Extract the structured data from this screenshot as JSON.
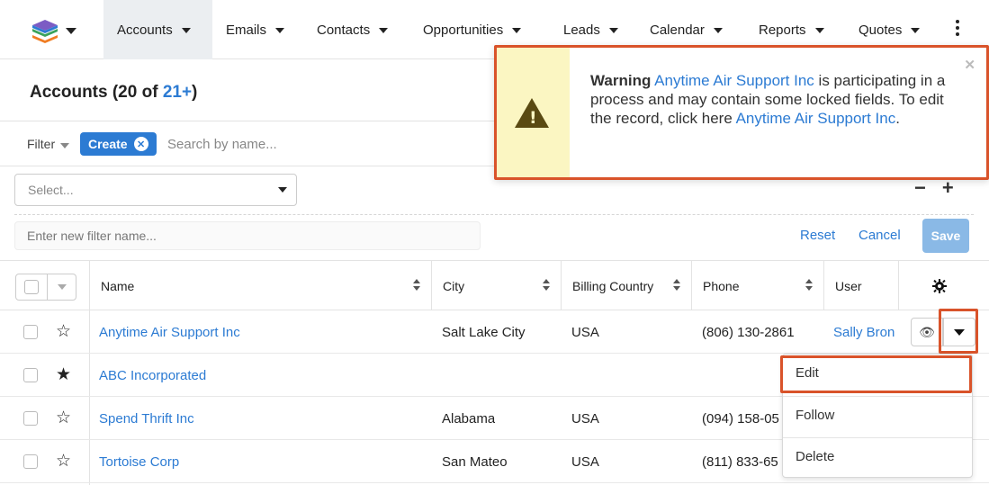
{
  "nav": {
    "items": [
      {
        "label": "Accounts"
      },
      {
        "label": "Emails"
      },
      {
        "label": "Contacts"
      },
      {
        "label": "Opportunities"
      },
      {
        "label": "Leads"
      },
      {
        "label": "Calendar"
      },
      {
        "label": "Reports"
      },
      {
        "label": "Quotes"
      }
    ]
  },
  "list": {
    "title_prefix": "Accounts (20 of ",
    "title_count": "21+",
    "title_suffix": ")"
  },
  "filter": {
    "label": "Filter",
    "create_pill": "Create",
    "search_placeholder": "Search by name...",
    "select_placeholder": "Select...",
    "filter_name_placeholder": "Enter new filter name...",
    "reset": "Reset",
    "cancel": "Cancel",
    "save": "Save"
  },
  "table": {
    "columns": [
      "Name",
      "City",
      "Billing Country",
      "Phone",
      "User"
    ],
    "rows": [
      {
        "name": "Anytime Air Support Inc",
        "city": "Salt Lake City",
        "country": "USA",
        "phone": "(806) 130-2861",
        "user": "Sally Bron",
        "favorite": false
      },
      {
        "name": "ABC Incorporated",
        "city": "",
        "country": "",
        "phone": "",
        "user": "",
        "favorite": true
      },
      {
        "name": "Spend Thrift Inc",
        "city": "Alabama",
        "country": "USA",
        "phone": "(094) 158-05",
        "user": "",
        "favorite": false
      },
      {
        "name": "Tortoise Corp",
        "city": "San Mateo",
        "country": "USA",
        "phone": "(811) 833-65",
        "user": "",
        "favorite": false
      }
    ]
  },
  "row_menu": {
    "items": [
      "Edit",
      "Follow",
      "Delete"
    ]
  },
  "warning": {
    "bold": "Warning",
    "record_link": "Anytime Air Support Inc",
    "message": " is participating in a process and may contain some locked fields. To edit the record, click here ",
    "edit_link": "Anytime Air Support Inc",
    "end": "."
  },
  "colors": {
    "accent": "#2c7bd3",
    "highlight": "#d9532a",
    "warning_bg": "#fbf6c2"
  },
  "icons": [
    "logo-icon",
    "caret-down-icon",
    "kebab-icon",
    "close-icon",
    "sort-icon",
    "gear-icon",
    "star-icon",
    "eye-icon",
    "warning-icon",
    "minus-icon",
    "plus-icon"
  ]
}
